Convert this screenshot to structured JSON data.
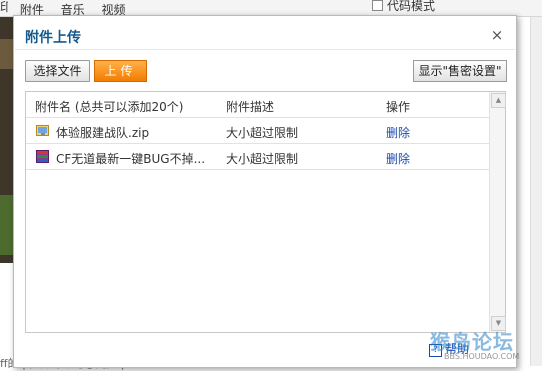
{
  "background": {
    "menu_items": [
      "印",
      "附件",
      "音乐",
      "视频"
    ],
    "code_mode_label": "代码模式",
    "bottom_text": "ff的 |   提升等级可@更多 |"
  },
  "dialog": {
    "title": "附件上传",
    "close_symbol": "×",
    "select_file_label": "选择文件",
    "upload_label": "上传",
    "settings_label": "显示\"售密设置\"",
    "columns": {
      "name": "附件名 (总共可以添加20个)",
      "description": "附件描述",
      "action": "操作"
    },
    "files": [
      {
        "name": "体验服建战队.zip",
        "description": "大小超过限制",
        "action": "删除",
        "icon": "zip-file-icon"
      },
      {
        "name": "CF无道最新一键BUG不掉...",
        "description": "大小超过限制",
        "action": "删除",
        "icon": "rar-file-icon"
      }
    ],
    "help_label": "帮助"
  },
  "watermark": {
    "text": "猴岛论坛",
    "sub": "BBS.HOUDAO.COM"
  },
  "colors": {
    "accent": "#f27c00",
    "title": "#145a90",
    "link": "#1a4cb0"
  }
}
